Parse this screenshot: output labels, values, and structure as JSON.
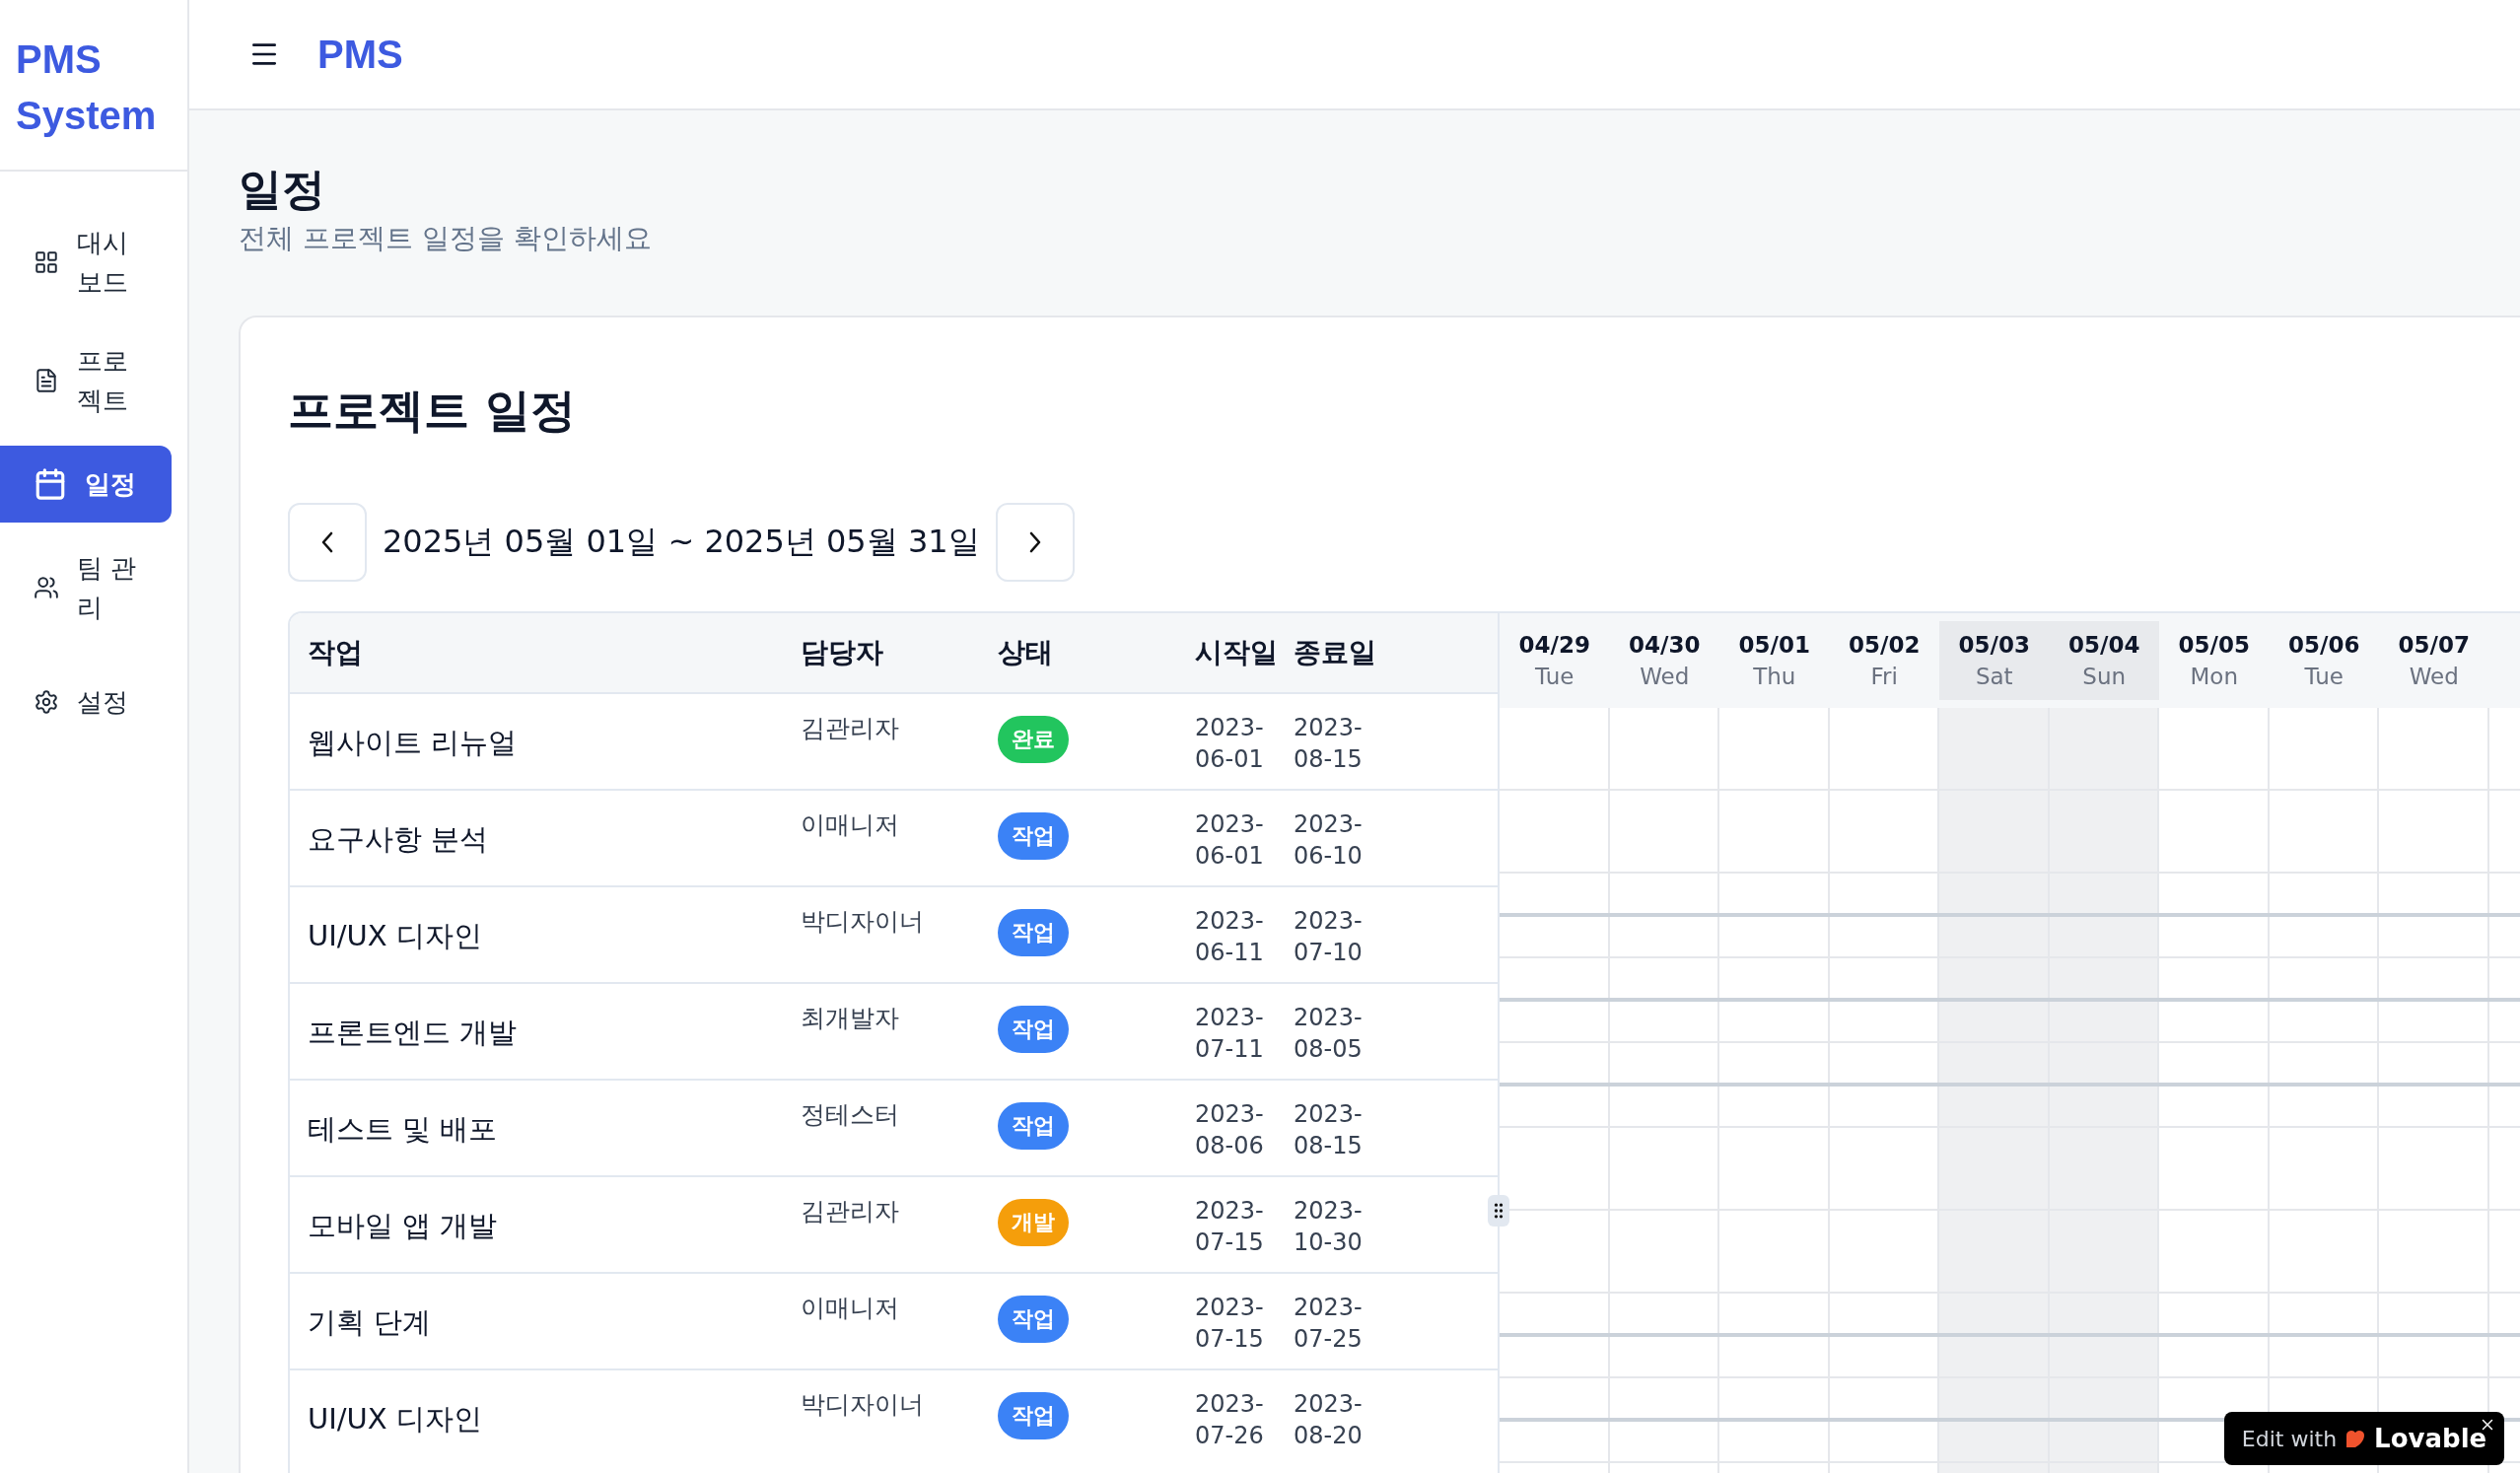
{
  "sidebar": {
    "logo": "PMS System",
    "items": [
      {
        "label": "대시보드",
        "selected": false
      },
      {
        "label": "프로젝트",
        "selected": false
      },
      {
        "label": "일정",
        "selected": true
      },
      {
        "label": "팀 관리",
        "selected": false
      },
      {
        "label": "설정",
        "selected": false
      }
    ]
  },
  "header": {
    "title": "PMS"
  },
  "page": {
    "title": "일정",
    "subtitle": "전체 프로젝트 일정을 확인하세요"
  },
  "card": {
    "title": "프로젝트 일정",
    "range": "2025년 05월 01일 ~ 2025년 05월 31일"
  },
  "table": {
    "columns": [
      "작업",
      "담당자",
      "상태",
      "시작일",
      "종료일"
    ],
    "rows": [
      {
        "task": "웹사이트 리뉴얼",
        "assignee": "김관리자",
        "status": "완료",
        "color": "#22c55e",
        "start": "2023-06-01",
        "end": "2023-08-15"
      },
      {
        "task": "요구사항 분석",
        "assignee": "이매니저",
        "status": "작업",
        "color": "#3b82f6",
        "start": "2023-06-01",
        "end": "2023-06-10"
      },
      {
        "task": "UI/UX 디자인",
        "assignee": "박디자이너",
        "status": "작업",
        "color": "#3b82f6",
        "start": "2023-06-11",
        "end": "2023-07-10"
      },
      {
        "task": "프론트엔드 개발",
        "assignee": "최개발자",
        "status": "작업",
        "color": "#3b82f6",
        "start": "2023-07-11",
        "end": "2023-08-05"
      },
      {
        "task": "테스트 및 배포",
        "assignee": "정테스터",
        "status": "작업",
        "color": "#3b82f6",
        "start": "2023-08-06",
        "end": "2023-08-15"
      },
      {
        "task": "모바일 앱 개발",
        "assignee": "김관리자",
        "status": "개발",
        "color": "#f59e0b",
        "start": "2023-07-15",
        "end": "2023-10-30"
      },
      {
        "task": "기획 단계",
        "assignee": "이매니저",
        "status": "작업",
        "color": "#3b82f6",
        "start": "2023-07-15",
        "end": "2023-07-25"
      },
      {
        "task": "UI/UX 디자인",
        "assignee": "박디자이너",
        "status": "작업",
        "color": "#3b82f6",
        "start": "2023-07-26",
        "end": "2023-08-20"
      }
    ]
  },
  "timeline": {
    "days": [
      {
        "date": "04/29",
        "weekday": "Tue",
        "weekend": false
      },
      {
        "date": "04/30",
        "weekday": "Wed",
        "weekend": false
      },
      {
        "date": "05/01",
        "weekday": "Thu",
        "weekend": false
      },
      {
        "date": "05/02",
        "weekday": "Fri",
        "weekend": false
      },
      {
        "date": "05/03",
        "weekday": "Sat",
        "weekend": true
      },
      {
        "date": "05/04",
        "weekday": "Sun",
        "weekend": true
      },
      {
        "date": "05/05",
        "weekday": "Mon",
        "weekend": false
      },
      {
        "date": "05/06",
        "weekday": "Tue",
        "weekend": false
      },
      {
        "date": "05/07",
        "weekday": "Wed",
        "weekend": false
      }
    ]
  },
  "badge": {
    "prefix": "Edit with",
    "brand": "Lovable"
  }
}
